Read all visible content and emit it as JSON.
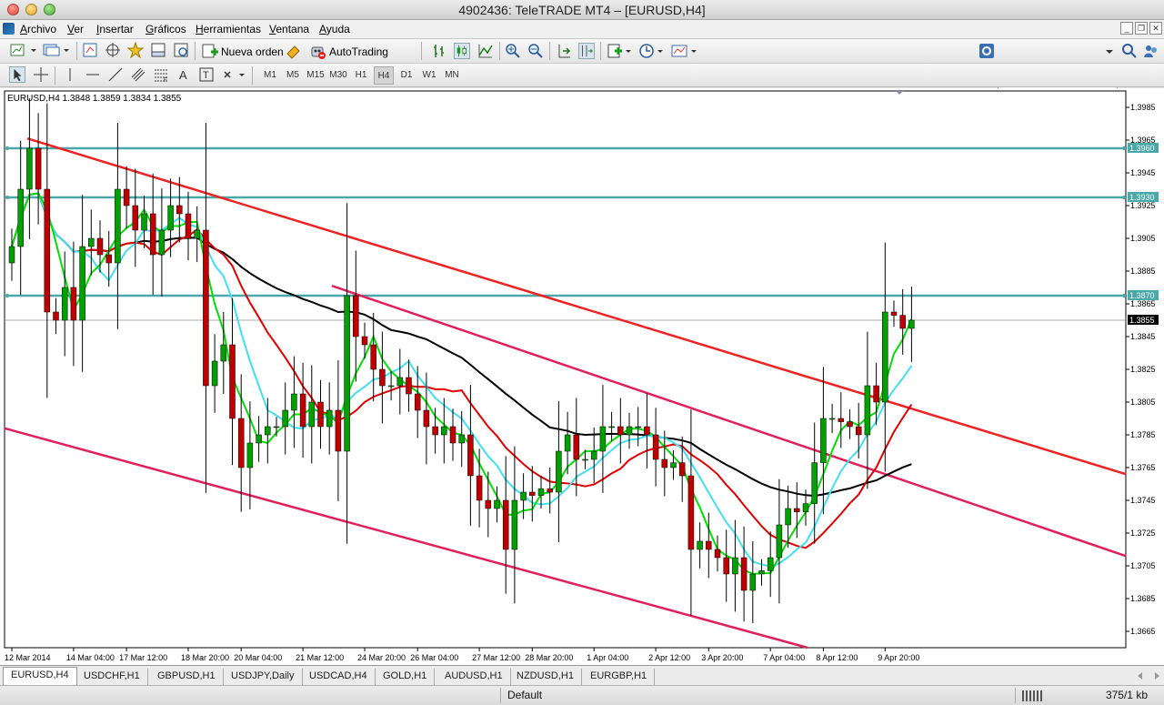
{
  "window": {
    "title": "4902436: TeleTRADE MT4 – [EURUSD,H4]"
  },
  "menu": [
    "Archivo",
    "Ver",
    "Insertar",
    "Gráficos",
    "Herramientas",
    "Ventana",
    "Ayuda"
  ],
  "toolbar": {
    "new_order_label": "Nueva orden",
    "autotrading_label": "AutoTrading",
    "search_value": "",
    "timeframes": [
      "M1",
      "M5",
      "M15",
      "M30",
      "H1",
      "H4",
      "D1",
      "W1",
      "MN"
    ],
    "active_timeframe": "H4"
  },
  "chart": {
    "header": "EURUSD,H4  1.3848  1.3859  1.3834  1.3855",
    "current_price": "1.3855",
    "colors": {
      "bull": "#00a000",
      "bear": "#c00000",
      "ma_green": "#00e000",
      "ma_cyan": "#40e0f0",
      "ma_red": "#e00000",
      "ma_black": "#000000",
      "trend_red": "#ee2222",
      "channel_pink": "#e0205a",
      "hline_teal": "#4aa8a8"
    }
  },
  "chart_data": {
    "type": "candlestick",
    "symbol": "EURUSD",
    "timeframe": "H4",
    "ohlc_last": {
      "open": 1.3848,
      "high": 1.3859,
      "low": 1.3834,
      "close": 1.3855
    },
    "ylim": [
      1.3655,
      1.3995
    ],
    "y_ticks": [
      "1.3985",
      "1.3965",
      "1.3945",
      "1.3925",
      "1.3905",
      "1.3885",
      "1.3865",
      "1.3845",
      "1.3825",
      "1.3805",
      "1.3785",
      "1.3765",
      "1.3745",
      "1.3725",
      "1.3705",
      "1.3685",
      "1.3665"
    ],
    "x_ticks": [
      "12 Mar 2014",
      "14 Mar 04:00",
      "17 Mar 12:00",
      "18 Mar 20:00",
      "20 Mar 04:00",
      "21 Mar 12:00",
      "24 Mar 20:00",
      "26 Mar 04:00",
      "27 Mar 12:00",
      "28 Mar 20:00",
      "1 Apr 04:00",
      "2 Apr 12:00",
      "3 Apr 20:00",
      "7 Apr 04:00",
      "8 Apr 12:00",
      "9 Apr 20:00"
    ],
    "horizontal_levels": [
      "1.3960",
      "1.3930",
      "1.3870"
    ],
    "closes": [
      1.39,
      1.3935,
      1.396,
      1.3935,
      1.386,
      1.3855,
      1.3875,
      1.3855,
      1.39,
      1.3905,
      1.3895,
      1.389,
      1.3935,
      1.3925,
      1.391,
      1.392,
      1.3895,
      1.391,
      1.3925,
      1.392,
      1.3905,
      1.391,
      1.3815,
      1.383,
      1.384,
      1.3795,
      1.3765,
      1.378,
      1.3785,
      1.379,
      1.379,
      1.38,
      1.381,
      1.379,
      1.3805,
      1.379,
      1.38,
      1.3775,
      1.387,
      1.3845,
      1.384,
      1.3825,
      1.3815,
      1.3815,
      1.382,
      1.381,
      1.38,
      1.379,
      1.3785,
      1.379,
      1.378,
      1.3785,
      1.376,
      1.3745,
      1.374,
      1.3745,
      1.3715,
      1.3745,
      1.375,
      1.3748,
      1.3752,
      1.375,
      1.3775,
      1.3785,
      1.377,
      1.377,
      1.3775,
      1.379,
      1.379,
      1.3785,
      1.379,
      1.379,
      1.3785,
      1.377,
      1.3765,
      1.3768,
      1.376,
      1.3715,
      1.372,
      1.3715,
      1.371,
      1.37,
      1.371,
      1.369,
      1.37,
      1.3702,
      1.371,
      1.373,
      1.374,
      1.3738,
      1.3743,
      1.3768,
      1.3795,
      1.3795,
      1.3793,
      1.379,
      1.3785,
      1.3815,
      1.3805,
      1.386,
      1.3858,
      1.385,
      1.3855
    ]
  },
  "symbol_tabs": [
    "EURUSD,H4",
    "USDCHF,H1",
    "GBPUSD,H1",
    "USDJPY,Daily",
    "USDCAD,H4",
    "GOLD,H1",
    "AUDUSD,H1",
    "NZDUSD,H1",
    "EURGBP,H1"
  ],
  "active_tab": "EURUSD,H4",
  "status": {
    "profile": "Default",
    "traffic": "375/1 kb"
  }
}
